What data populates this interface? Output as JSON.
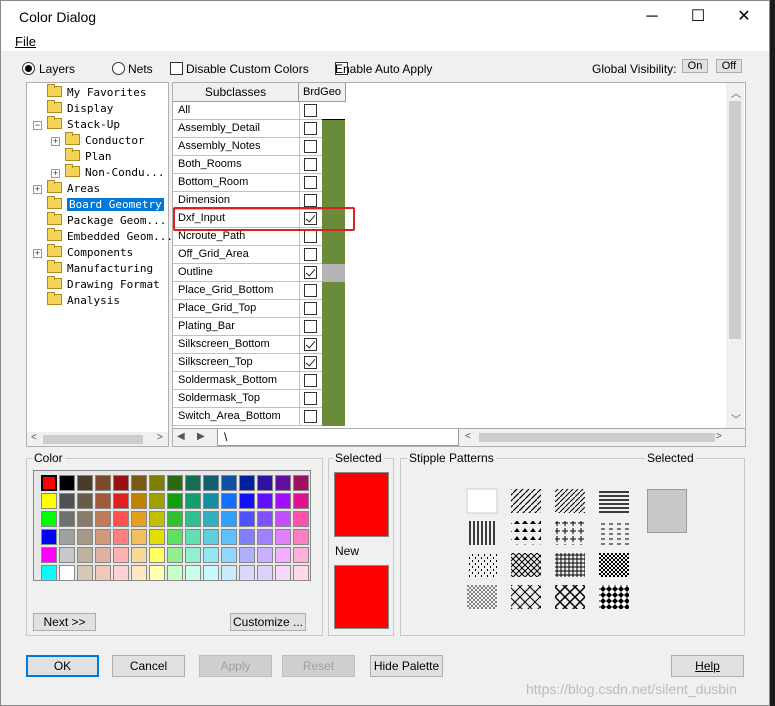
{
  "window": {
    "title": "Color Dialog",
    "menu_file": "File",
    "minimize_icon": "─",
    "maximize_icon": "☐",
    "close_icon": "✕"
  },
  "toolbar": {
    "layers": "Layers",
    "nets": "Nets",
    "disable_custom_colors": "Disable Custom Colors",
    "enable_auto_apply": "Enable Auto Apply",
    "global_visibility": "Global Visibility:",
    "on": "On",
    "off": "Off"
  },
  "tree": [
    {
      "label": "My Favorites",
      "indent": 0,
      "expander": false,
      "selected": false
    },
    {
      "label": "Display",
      "indent": 0,
      "expander": false,
      "selected": false
    },
    {
      "label": "Stack-Up",
      "indent": 0,
      "expander": "minus",
      "selected": false
    },
    {
      "label": "Conductor",
      "indent": 1,
      "expander": "plus",
      "selected": false
    },
    {
      "label": "Plan",
      "indent": 1,
      "expander": false,
      "selected": false
    },
    {
      "label": "Non-Condu...",
      "indent": 1,
      "expander": "plus",
      "selected": false
    },
    {
      "label": "Areas",
      "indent": 0,
      "expander": "plus",
      "selected": false
    },
    {
      "label": "Board Geometry",
      "indent": 0,
      "expander": false,
      "selected": true
    },
    {
      "label": "Package Geom...",
      "indent": 0,
      "expander": false,
      "selected": false
    },
    {
      "label": "Embedded Geom...",
      "indent": 0,
      "expander": false,
      "selected": false
    },
    {
      "label": "Components",
      "indent": 0,
      "expander": "plus",
      "selected": false
    },
    {
      "label": "Manufacturing",
      "indent": 0,
      "expander": false,
      "selected": false
    },
    {
      "label": "Drawing Format",
      "indent": 0,
      "expander": false,
      "selected": false
    },
    {
      "label": "Analysis",
      "indent": 0,
      "expander": false,
      "selected": false
    }
  ],
  "grid": {
    "header_subclasses": "Subclasses",
    "header_col": "BrdGeo",
    "tab_label": "\\",
    "rows": [
      {
        "name": "All",
        "checked": false,
        "color": null
      },
      {
        "name": "Assembly_Detail",
        "checked": false,
        "color": "#6a8b3a"
      },
      {
        "name": "Assembly_Notes",
        "checked": false,
        "color": "#6a8b3a"
      },
      {
        "name": "Both_Rooms",
        "checked": false,
        "color": "#6a8b3a"
      },
      {
        "name": "Bottom_Room",
        "checked": false,
        "color": "#6a8b3a"
      },
      {
        "name": "Dimension",
        "checked": false,
        "color": "#6a8b3a"
      },
      {
        "name": "Dxf_Input",
        "checked": true,
        "color": "#6a8b3a"
      },
      {
        "name": "Ncroute_Path",
        "checked": false,
        "color": "#6a8b3a"
      },
      {
        "name": "Off_Grid_Area",
        "checked": false,
        "color": "#6a8b3a"
      },
      {
        "name": "Outline",
        "checked": true,
        "color": "#b4b4b4"
      },
      {
        "name": "Place_Grid_Bottom",
        "checked": false,
        "color": "#6a8b3a"
      },
      {
        "name": "Place_Grid_Top",
        "checked": false,
        "color": "#6a8b3a"
      },
      {
        "name": "Plating_Bar",
        "checked": false,
        "color": "#6a8b3a"
      },
      {
        "name": "Silkscreen_Bottom",
        "checked": true,
        "color": "#6a8b3a"
      },
      {
        "name": "Silkscreen_Top",
        "checked": true,
        "color": "#6a8b3a"
      },
      {
        "name": "Soldermask_Bottom",
        "checked": false,
        "color": "#6a8b3a"
      },
      {
        "name": "Soldermask_Top",
        "checked": false,
        "color": "#6a8b3a"
      },
      {
        "name": "Switch_Area_Bottom",
        "checked": false,
        "color": "#6a8b3a"
      }
    ],
    "highlight_row": "Dxf_Input",
    "highlight_color": "#e02020"
  },
  "color": {
    "label": "Color",
    "palette": [
      [
        "#ff0000",
        "#000000",
        "#4a3a2a",
        "#7a4a2a",
        "#9a1010",
        "#7a5a10",
        "#808000",
        "#2a6a10",
        "#107050",
        "#106070",
        "#1050a0",
        "#0020a0",
        "#3010a0",
        "#6010a0",
        "#a01060"
      ],
      [
        "#ffff00",
        "#505050",
        "#6a5a4a",
        "#a05a3a",
        "#e02020",
        "#c08000",
        "#a0a000",
        "#10a010",
        "#10a070",
        "#1090a0",
        "#1070ff",
        "#1010ff",
        "#6010ff",
        "#a010ff",
        "#e01090"
      ],
      [
        "#00ff00",
        "#707070",
        "#8a7a6a",
        "#c07a5a",
        "#ff5050",
        "#e0a020",
        "#c0c000",
        "#30c030",
        "#30c090",
        "#30b0c0",
        "#30a0ff",
        "#5050ff",
        "#8050ff",
        "#c050ff",
        "#ff50b0"
      ],
      [
        "#0000ff",
        "#a0a0a0",
        "#a89888",
        "#d09a7a",
        "#ff8080",
        "#f0c060",
        "#e0e000",
        "#60e060",
        "#60e0b0",
        "#60d0e0",
        "#60c0ff",
        "#8080ff",
        "#a080ff",
        "#e080ff",
        "#ff80c0"
      ],
      [
        "#ff00ff",
        "#c8c8c8",
        "#c0b0a0",
        "#e0b0a0",
        "#ffb0b0",
        "#f8d898",
        "#ffff60",
        "#90f090",
        "#90f0d0",
        "#90e8f0",
        "#90d8ff",
        "#b0b0ff",
        "#c8b0ff",
        "#f0b0ff",
        "#ffb0d8"
      ],
      [
        "#00ffff",
        "#ffffff",
        "#d8c8b8",
        "#f0c8b8",
        "#ffd0d0",
        "#ffe8c0",
        "#ffffb0",
        "#c8ffc8",
        "#c8ffe8",
        "#c8f8ff",
        "#c8ecff",
        "#d8d8ff",
        "#e0d0ff",
        "#f8d8ff",
        "#ffd8ec"
      ]
    ],
    "next_button": "Next >>",
    "customize_button": "Customize ...",
    "selected_label": "Selected",
    "selected_color": "#ff0000",
    "new_label": "New",
    "new_color": "#ff0000"
  },
  "stipple": {
    "label": "Stipple Patterns",
    "selected_label": "Selected",
    "selected_color": "#c8c8c8"
  },
  "buttons": {
    "ok": "OK",
    "cancel": "Cancel",
    "apply": "Apply",
    "reset": "Reset",
    "hide_palette": "Hide Palette",
    "help": "Help"
  },
  "watermark": "https://blog.csdn.net/silent_dusbin"
}
